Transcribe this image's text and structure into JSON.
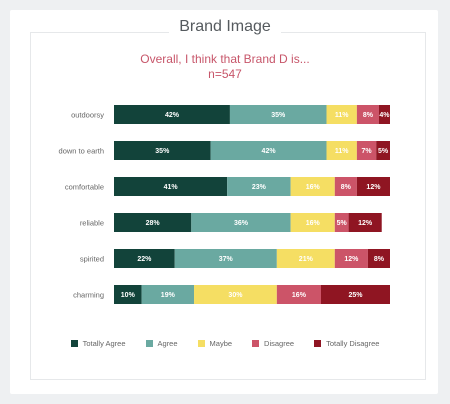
{
  "title": "Brand Image",
  "subtitle_line1": "Overall, I think that Brand D is...",
  "subtitle_line2": "n=547",
  "chart_data": {
    "type": "bar",
    "orientation": "horizontal",
    "stacked": true,
    "percent": true,
    "categories": [
      "outdoorsy",
      "down to earth",
      "comfortable",
      "reliable",
      "spirited",
      "charming"
    ],
    "series": [
      {
        "name": "Totally Agree",
        "color": "#12433a",
        "values": [
          42,
          35,
          41,
          28,
          22,
          10
        ]
      },
      {
        "name": "Agree",
        "color": "#6aa9a1",
        "values": [
          35,
          42,
          23,
          36,
          37,
          19
        ]
      },
      {
        "name": "Maybe",
        "color": "#f5de63",
        "values": [
          11,
          11,
          16,
          16,
          21,
          30
        ]
      },
      {
        "name": "Disagree",
        "color": "#cc5468",
        "values": [
          8,
          7,
          8,
          5,
          12,
          16
        ]
      },
      {
        "name": "Totally Disagree",
        "color": "#8f1522",
        "values": [
          4,
          5,
          12,
          12,
          8,
          25
        ]
      }
    ],
    "legend_position": "bottom",
    "grid": false
  }
}
